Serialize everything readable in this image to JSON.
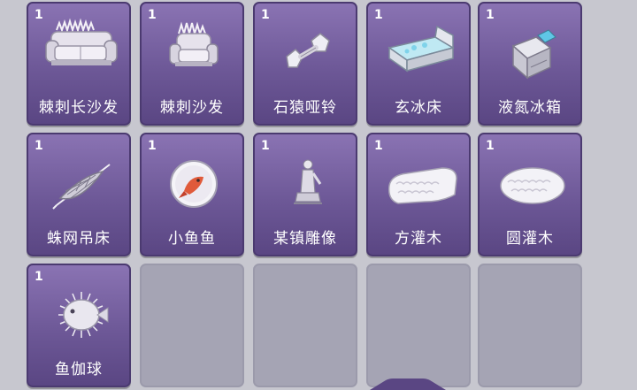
{
  "inventory": {
    "items": [
      {
        "name": "棘刺长沙发",
        "count": "1",
        "icon": "thorn-long-sofa-icon"
      },
      {
        "name": "棘刺沙发",
        "count": "1",
        "icon": "thorn-sofa-icon"
      },
      {
        "name": "石猿哑铃",
        "count": "1",
        "icon": "stone-dumbbell-icon"
      },
      {
        "name": "玄冰床",
        "count": "1",
        "icon": "ice-bed-icon"
      },
      {
        "name": "液氮冰箱",
        "count": "1",
        "icon": "liquid-nitrogen-fridge-icon"
      },
      {
        "name": "蛛网吊床",
        "count": "1",
        "icon": "spider-web-hammock-icon"
      },
      {
        "name": "小鱼鱼",
        "count": "1",
        "icon": "little-fish-bowl-icon"
      },
      {
        "name": "某镇雕像",
        "count": "1",
        "icon": "town-statue-icon"
      },
      {
        "name": "方灌木",
        "count": "1",
        "icon": "square-shrub-icon"
      },
      {
        "name": "圆灌木",
        "count": "1",
        "icon": "round-shrub-icon"
      },
      {
        "name": "鱼伽球",
        "count": "1",
        "icon": "pufferfish-ball-icon"
      }
    ],
    "colors": {
      "slot_filled": "#6d5897",
      "slot_empty": "#a5a4b4",
      "background": "#c7c7cf",
      "text": "#ffffff"
    }
  }
}
